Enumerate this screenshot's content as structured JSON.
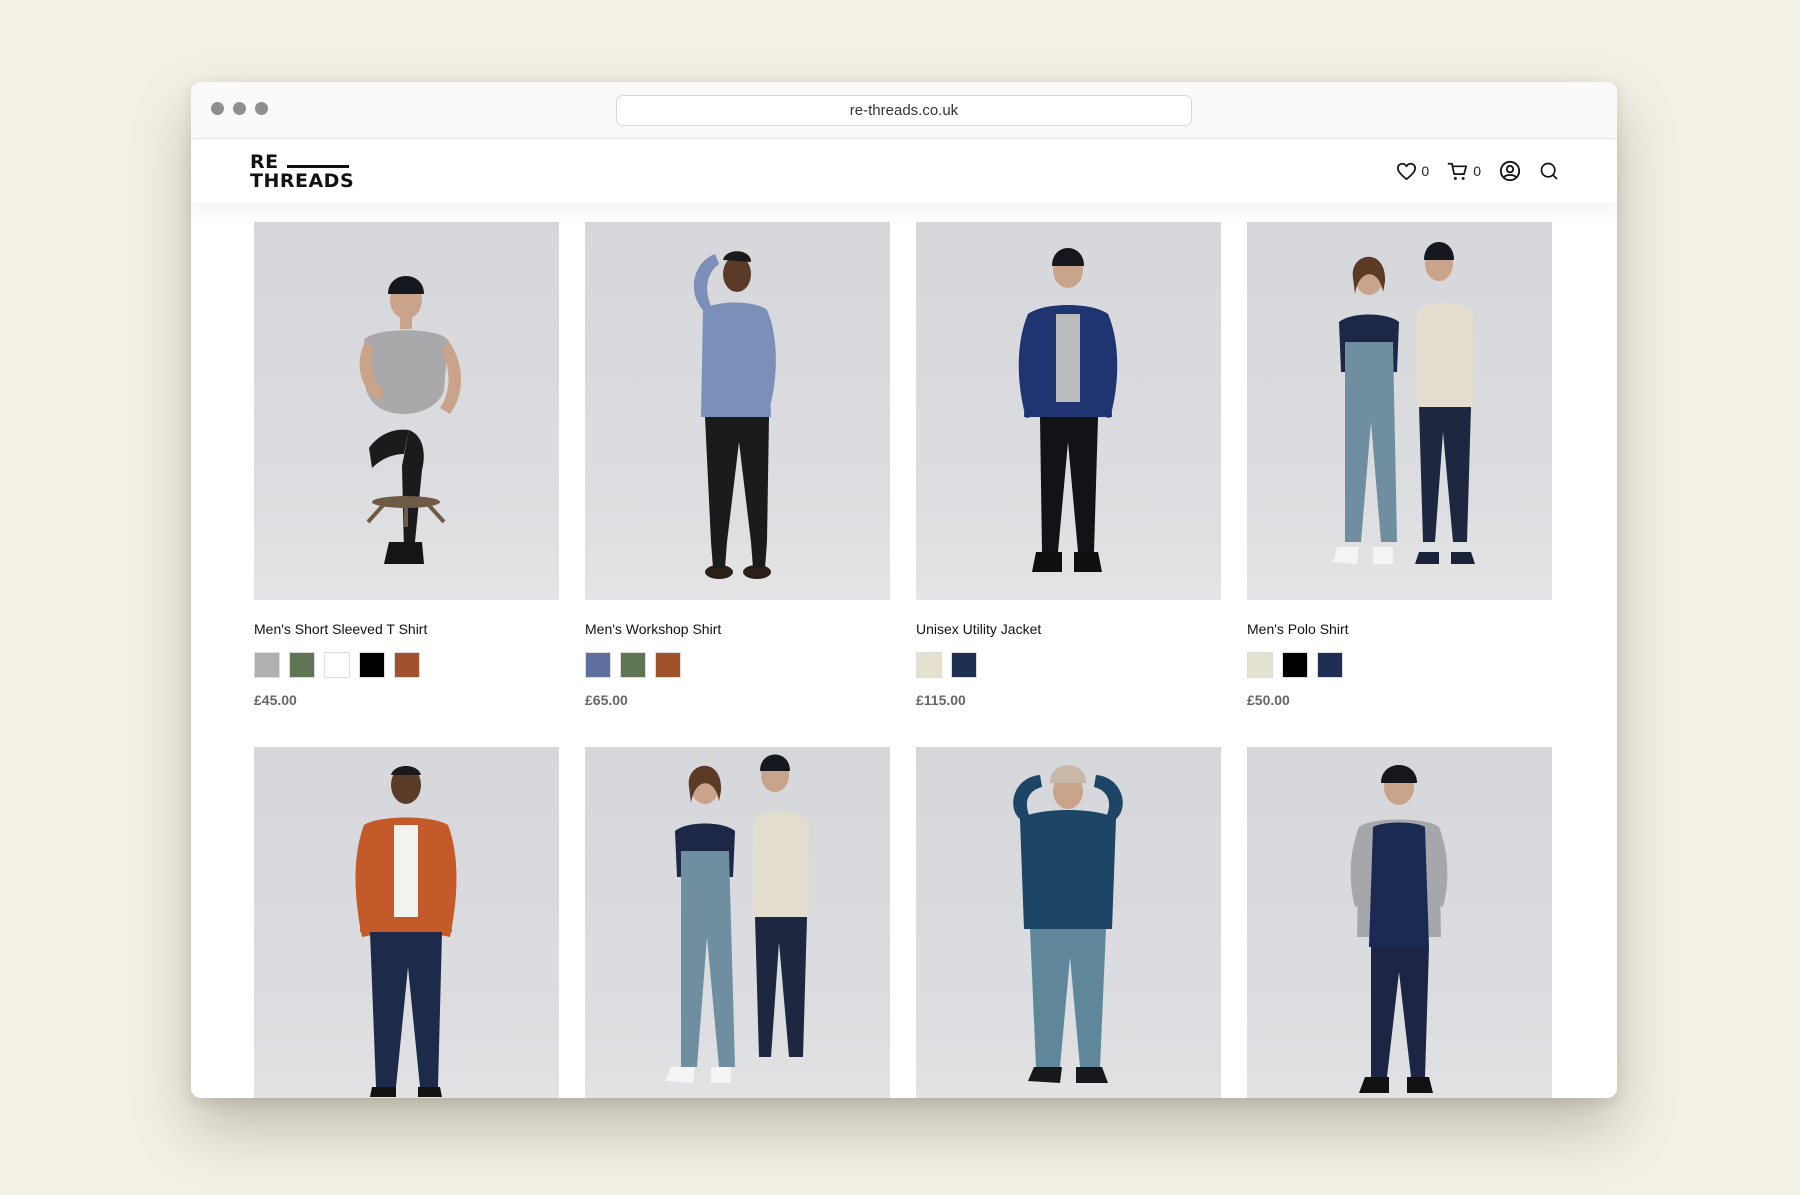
{
  "browser": {
    "url": "re-threads.co.uk"
  },
  "site": {
    "logo_top": "RE",
    "logo_bottom": "THREADS",
    "wishlist_count": "0",
    "cart_count": "0",
    "icons": [
      "heart-icon",
      "cart-icon",
      "account-icon",
      "search-icon"
    ]
  },
  "products": [
    {
      "name": "Men's Short Sleeved T Shirt",
      "price": "£45.00",
      "swatches": [
        "#b0b0b0",
        "#5f7553",
        "#ffffff",
        "#000000",
        "#a0522d"
      ]
    },
    {
      "name": "Men's Workshop Shirt",
      "price": "£65.00",
      "swatches": [
        "#5f6f9e",
        "#5f7553",
        "#a0522d"
      ]
    },
    {
      "name": "Unisex Utility Jacket",
      "price": "£115.00",
      "swatches": [
        "#e5e1d1",
        "#1f2f52"
      ]
    },
    {
      "name": "Men's Polo Shirt",
      "price": "£50.00",
      "swatches": [
        "#e5e1d1",
        "#000000",
        "#1f2f52"
      ]
    },
    {
      "name": "",
      "price": "",
      "swatches": []
    },
    {
      "name": "",
      "price": "",
      "swatches": []
    },
    {
      "name": "",
      "price": "",
      "swatches": []
    },
    {
      "name": "",
      "price": "",
      "swatches": []
    }
  ]
}
